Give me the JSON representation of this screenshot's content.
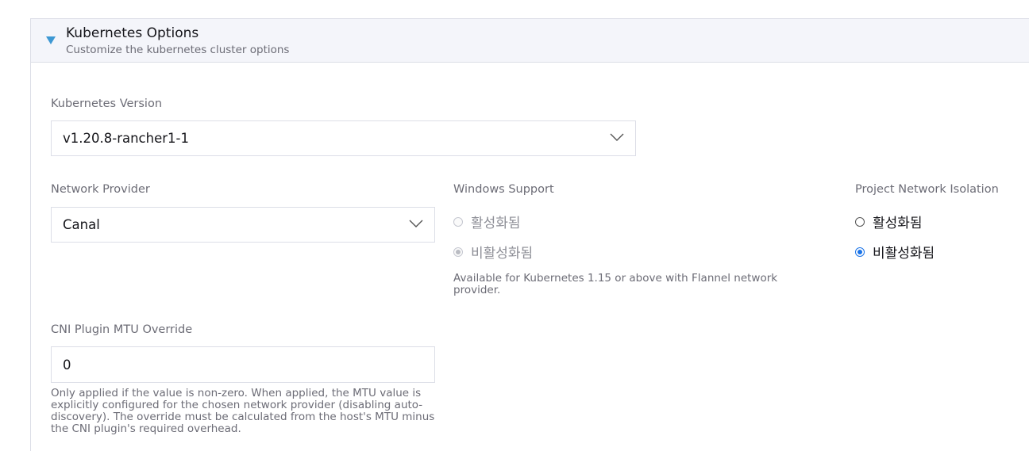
{
  "section": {
    "title": "Kubernetes Options",
    "subtitle": "Customize the kubernetes cluster options"
  },
  "k8s_version": {
    "label": "Kubernetes Version",
    "value": "v1.20.8-rancher1-1"
  },
  "network_provider": {
    "label": "Network Provider",
    "value": "Canal"
  },
  "windows_support": {
    "label": "Windows Support",
    "options": [
      {
        "label": "활성화됨",
        "selected": false,
        "disabled": true
      },
      {
        "label": "비활성화됨",
        "selected": true,
        "disabled": true
      }
    ],
    "help": "Available for Kubernetes 1.15 or above with Flannel network provider."
  },
  "project_network_isolation": {
    "label": "Project Network Isolation",
    "options": [
      {
        "label": "활성화됨",
        "selected": false
      },
      {
        "label": "비활성화됨",
        "selected": true
      }
    ]
  },
  "cni_mtu": {
    "label": "CNI Plugin MTU Override",
    "value": "0",
    "help": "Only applied if the value is non-zero. When applied, the MTU value is explicitly configured for the chosen network provider (disabling auto-discovery). The override must be calculated from the host's MTU minus the CNI plugin's required overhead."
  },
  "colors": {
    "accent": "#3d98d3",
    "radio_selected": "#1a73e8",
    "border": "#dcdee7",
    "header_bg": "#f4f5fa"
  }
}
